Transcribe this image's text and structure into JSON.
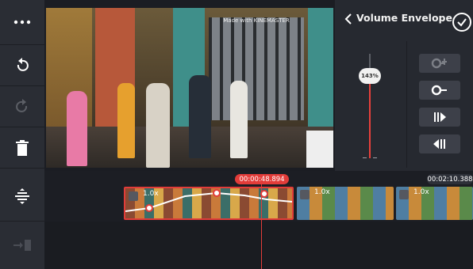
{
  "left_toolbar": {
    "items": [
      {
        "name": "more-options",
        "icon": "ellipsis-icon"
      },
      {
        "name": "undo",
        "icon": "undo-icon"
      },
      {
        "name": "redo",
        "icon": "redo-icon"
      },
      {
        "name": "delete",
        "icon": "trash-icon"
      },
      {
        "name": "layer-adjust",
        "icon": "layer-split-icon"
      },
      {
        "name": "add-layer",
        "icon": "add-layer-icon"
      }
    ]
  },
  "preview": {
    "watermark": "Made with KINEMASTER"
  },
  "panel": {
    "title": "Volume Envelope",
    "volume": 143,
    "volume_label": "143%",
    "keyframe_buttons": [
      {
        "name": "add-keyframe",
        "icon": "add-keyframe-icon"
      },
      {
        "name": "remove-keyframe",
        "icon": "remove-keyframe-icon"
      },
      {
        "name": "previous-keyframe",
        "icon": "previous-keyframe-icon"
      },
      {
        "name": "next-keyframe",
        "icon": "next-keyframe-icon"
      }
    ]
  },
  "timeline": {
    "current_time": "00:00:48.894",
    "total_time": "00:02:10.388",
    "clips": [
      {
        "speed": "1.0x",
        "selected": true
      },
      {
        "speed": "1.0x",
        "selected": false
      },
      {
        "speed": "1.0x",
        "selected": false
      }
    ]
  },
  "colors": {
    "accent": "#e23c39",
    "panel_bg": "#262930",
    "toolbar_bg": "#2a2d34",
    "timeline_bg": "#1c1e24"
  }
}
